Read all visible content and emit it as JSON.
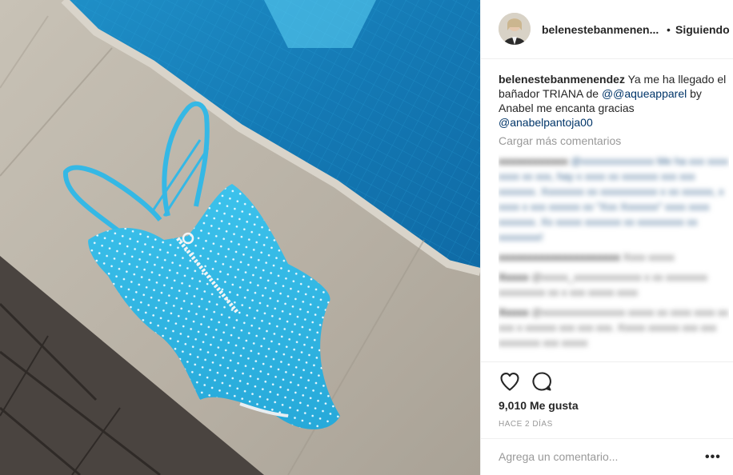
{
  "post": {
    "username": "belenestebanmenendez",
    "username_truncated": "belenestebanmenen...",
    "separator": "•",
    "follow_label": "Siguiendo",
    "caption": {
      "user": "belenestebanmenendez",
      "text": " Ya me ha llegado el bañador TRIANA de ",
      "mention1": "@@aqueapparel",
      "text2": " by Anabel me encanta gracias ",
      "mention2": "@anabelpantoja00"
    },
    "load_more_label": "Cargar más comentarios",
    "likes_count": "9,010",
    "likes_label": "Me gusta",
    "time_ago": "HACE 2 DÍAS",
    "add_comment_placeholder": "Agrega un comentario...",
    "more_label": "•••"
  },
  "blurred_comments": [
    {
      "user": "xxxxxxxxxxxx",
      "text": " @xxxxxxxxxxxxxx Me ha xxx xxxx xxxx xx xxx, hay x xxxx xx xxxxxxx xxx xxx xxxxxxx. Xxxxxxxx xx xxxxxxxxxxx x xx xxxxxx, x xxxx x xxx xxxxxx xx \"Xxx Xxxxxxx\" xxxx xxxx xxxxxxx. Xx xxxxx xxxxxxx xx xxxxxxxxx xx xxxxxxxx!"
    },
    {
      "user": "xxxxxxxxxxxxxxxxxxxxx",
      "text": " Xxxx xxxxx"
    },
    {
      "user": "Xxxxx",
      "text": " @xxxxx_xxxxxxxxxxxxx x xx xxxxxxxx xxxxxxxxx xx x xxx xxxxx xxxx"
    },
    {
      "user": "Xxxxx",
      "text": " @xxxxxxxxxxxxxxxx xxxxx xx xxxx xxxx xx xxx x xxxxxx xxx xxx xxx. Xxxxx xxxxxx xxx xxx xxxxxxxx xxx xxxxx"
    }
  ],
  "icons": {
    "heart": "heart-icon",
    "comment": "comment-icon"
  }
}
